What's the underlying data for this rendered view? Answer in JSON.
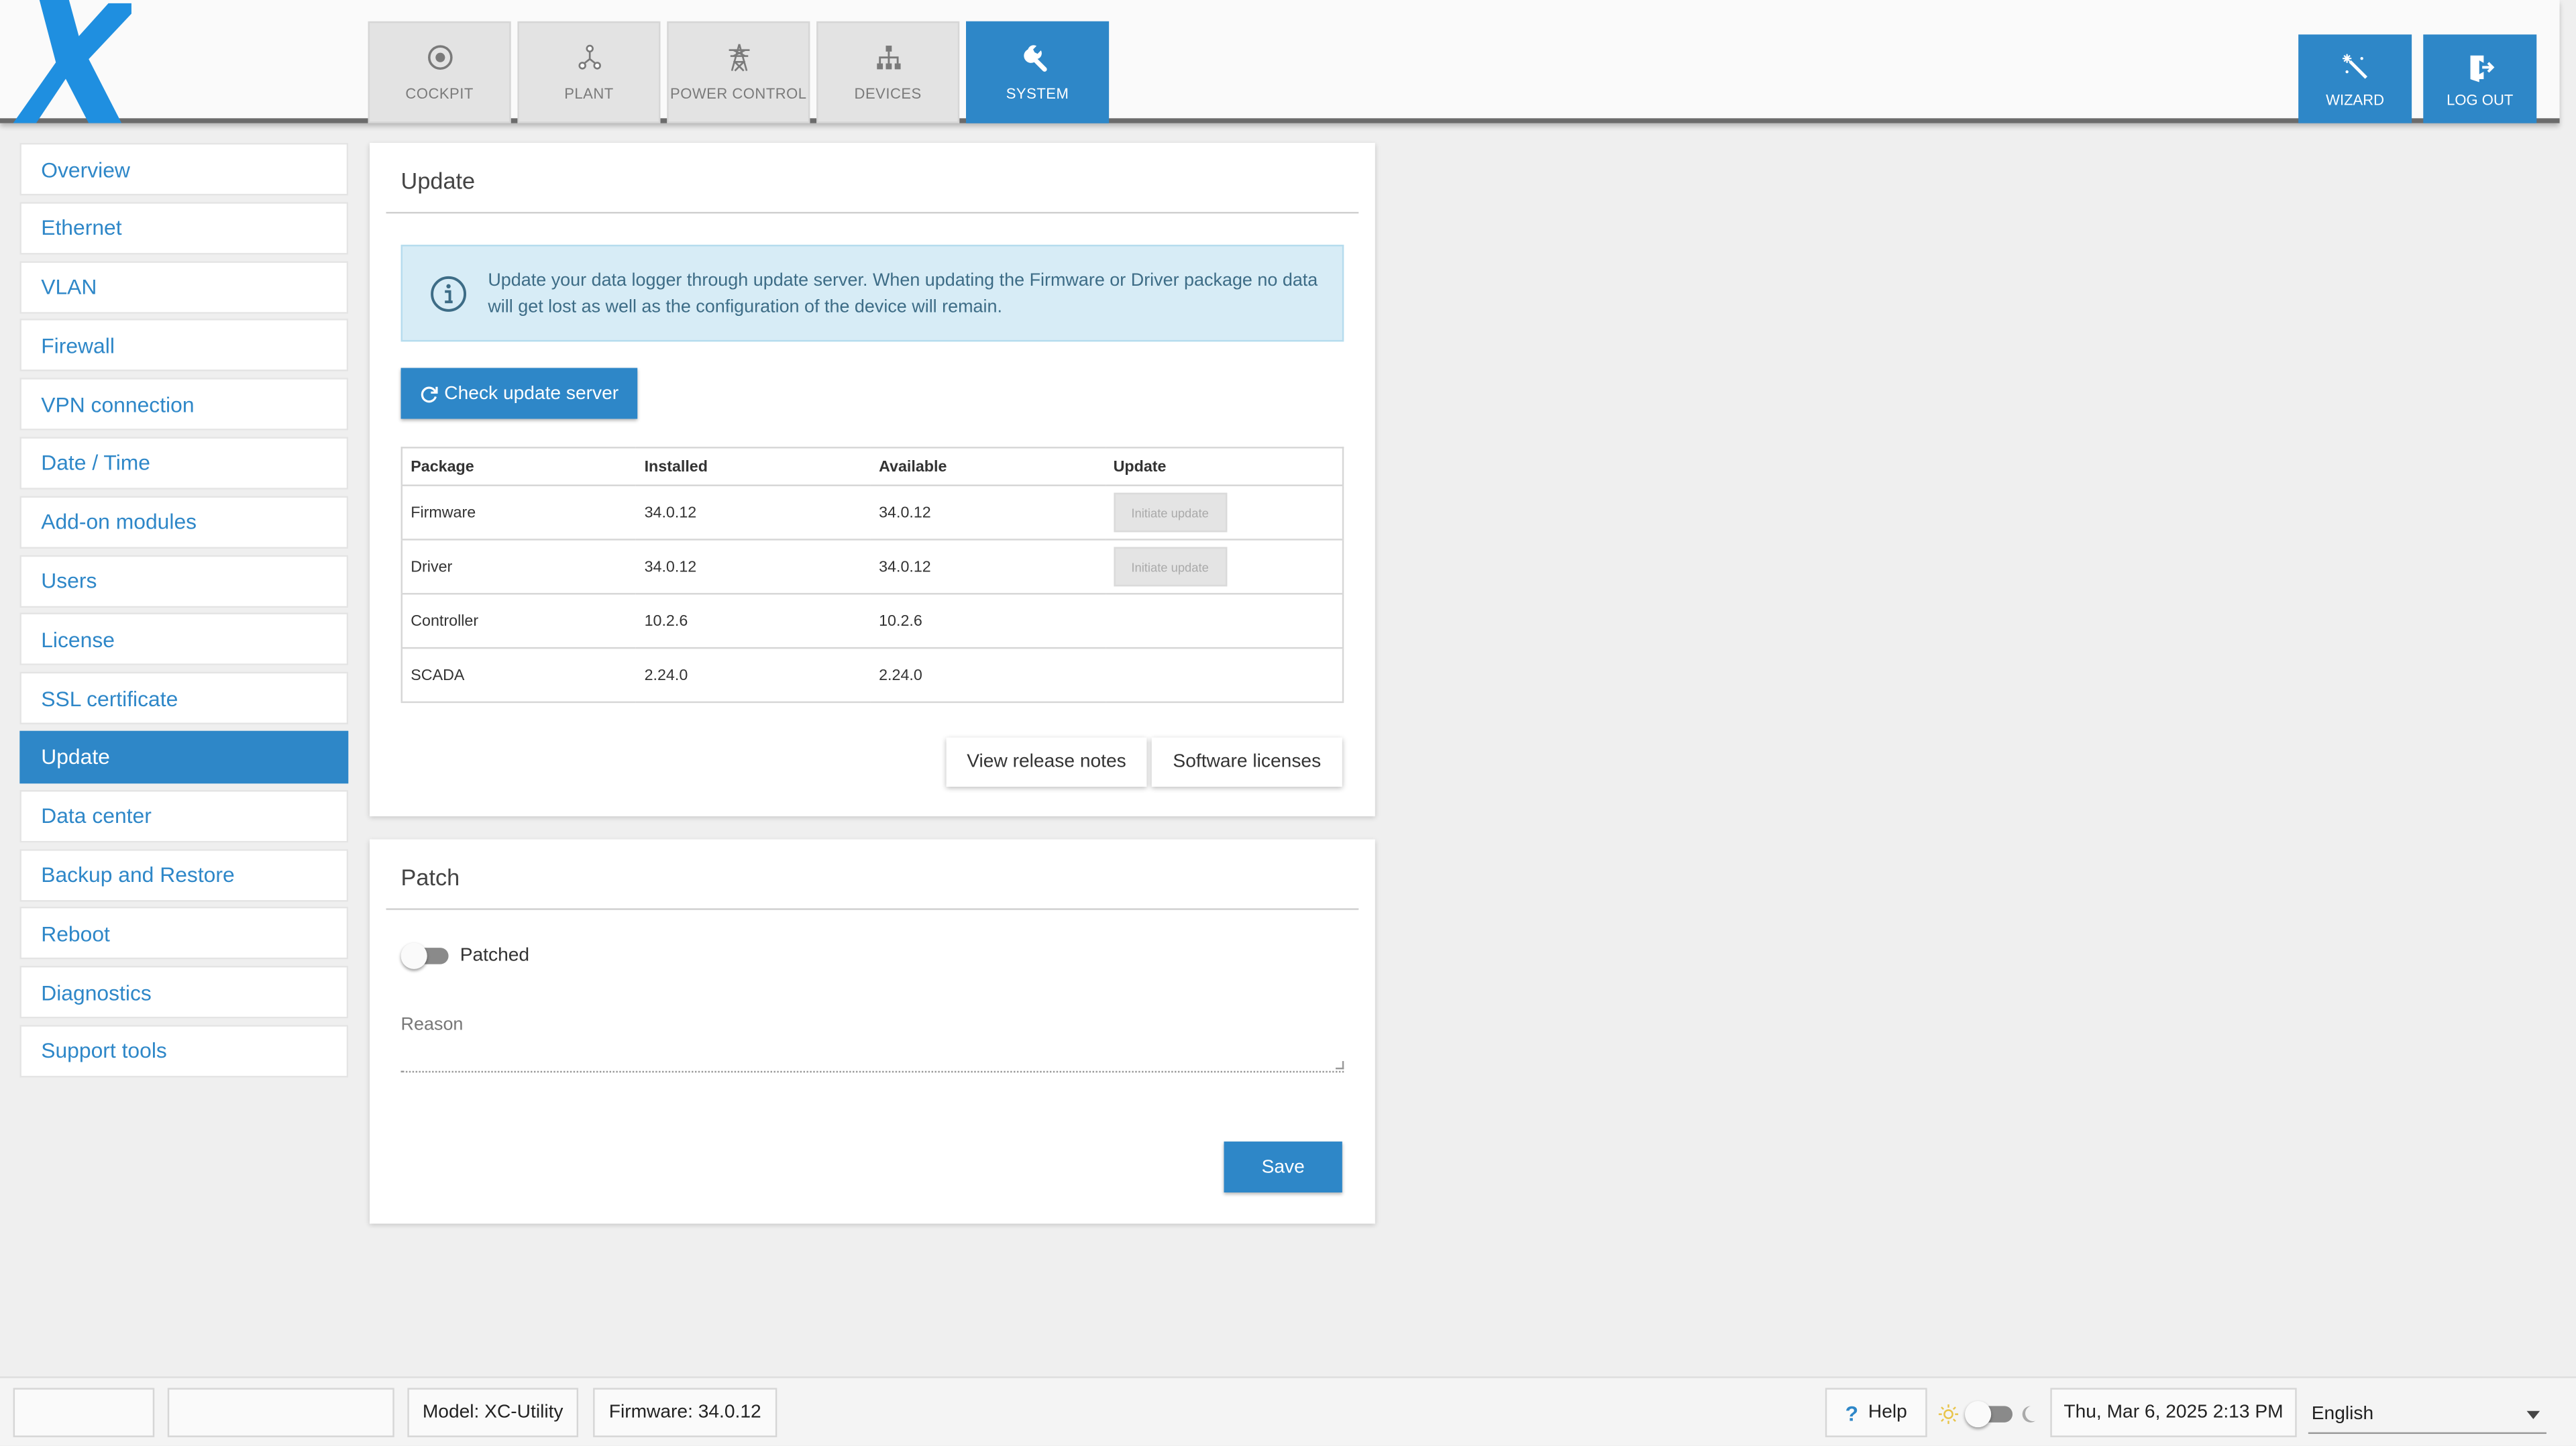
{
  "nav": {
    "tabs": [
      {
        "label": "COCKPIT",
        "icon": "target-icon"
      },
      {
        "label": "PLANT",
        "icon": "nodes-icon"
      },
      {
        "label": "POWER CONTROL",
        "icon": "power-tower-icon"
      },
      {
        "label": "DEVICES",
        "icon": "hierarchy-icon"
      },
      {
        "label": "SYSTEM",
        "icon": "wrench-icon",
        "active": true
      }
    ],
    "actions": [
      {
        "label": "WIZARD",
        "icon": "magic-wand-icon"
      },
      {
        "label": "LOG OUT",
        "icon": "logout-icon"
      }
    ]
  },
  "sidebar": {
    "items": [
      {
        "label": "Overview"
      },
      {
        "label": "Ethernet"
      },
      {
        "label": "VLAN"
      },
      {
        "label": "Firewall"
      },
      {
        "label": "VPN connection"
      },
      {
        "label": "Date / Time"
      },
      {
        "label": "Add-on modules"
      },
      {
        "label": "Users"
      },
      {
        "label": "License"
      },
      {
        "label": "SSL certificate"
      },
      {
        "label": "Update",
        "active": true
      },
      {
        "label": "Data center"
      },
      {
        "label": "Backup and Restore"
      },
      {
        "label": "Reboot"
      },
      {
        "label": "Diagnostics"
      },
      {
        "label": "Support tools"
      }
    ]
  },
  "update": {
    "title": "Update",
    "info": "Update your data logger through update server. When updating the Firmware or Driver package no data will get lost as well as the configuration of the device will remain.",
    "check_button": "Check update server",
    "table": {
      "headers": [
        "Package",
        "Installed",
        "Available",
        "Update"
      ],
      "rows": [
        {
          "package": "Firmware",
          "installed": "34.0.12",
          "available": "34.0.12",
          "action": "Initiate update"
        },
        {
          "package": "Driver",
          "installed": "34.0.12",
          "available": "34.0.12",
          "action": "Initiate update"
        },
        {
          "package": "Controller",
          "installed": "10.2.6",
          "available": "10.2.6",
          "action": ""
        },
        {
          "package": "SCADA",
          "installed": "2.24.0",
          "available": "2.24.0",
          "action": ""
        }
      ]
    },
    "release_notes_button": "View release notes",
    "licenses_button": "Software licenses"
  },
  "patch": {
    "title": "Patch",
    "toggle_label": "Patched",
    "toggle_on": false,
    "reason_label": "Reason",
    "reason_value": "",
    "save_button": "Save"
  },
  "footer": {
    "model": "Model: XC-Utility",
    "firmware": "Firmware: 34.0.12",
    "help": "Help",
    "datetime": "Thu, Mar 6, 2025 2:13 PM",
    "language": "English"
  },
  "colors": {
    "accent": "#2e87c8",
    "logo": "#1f8fe0",
    "background": "#efefef"
  }
}
